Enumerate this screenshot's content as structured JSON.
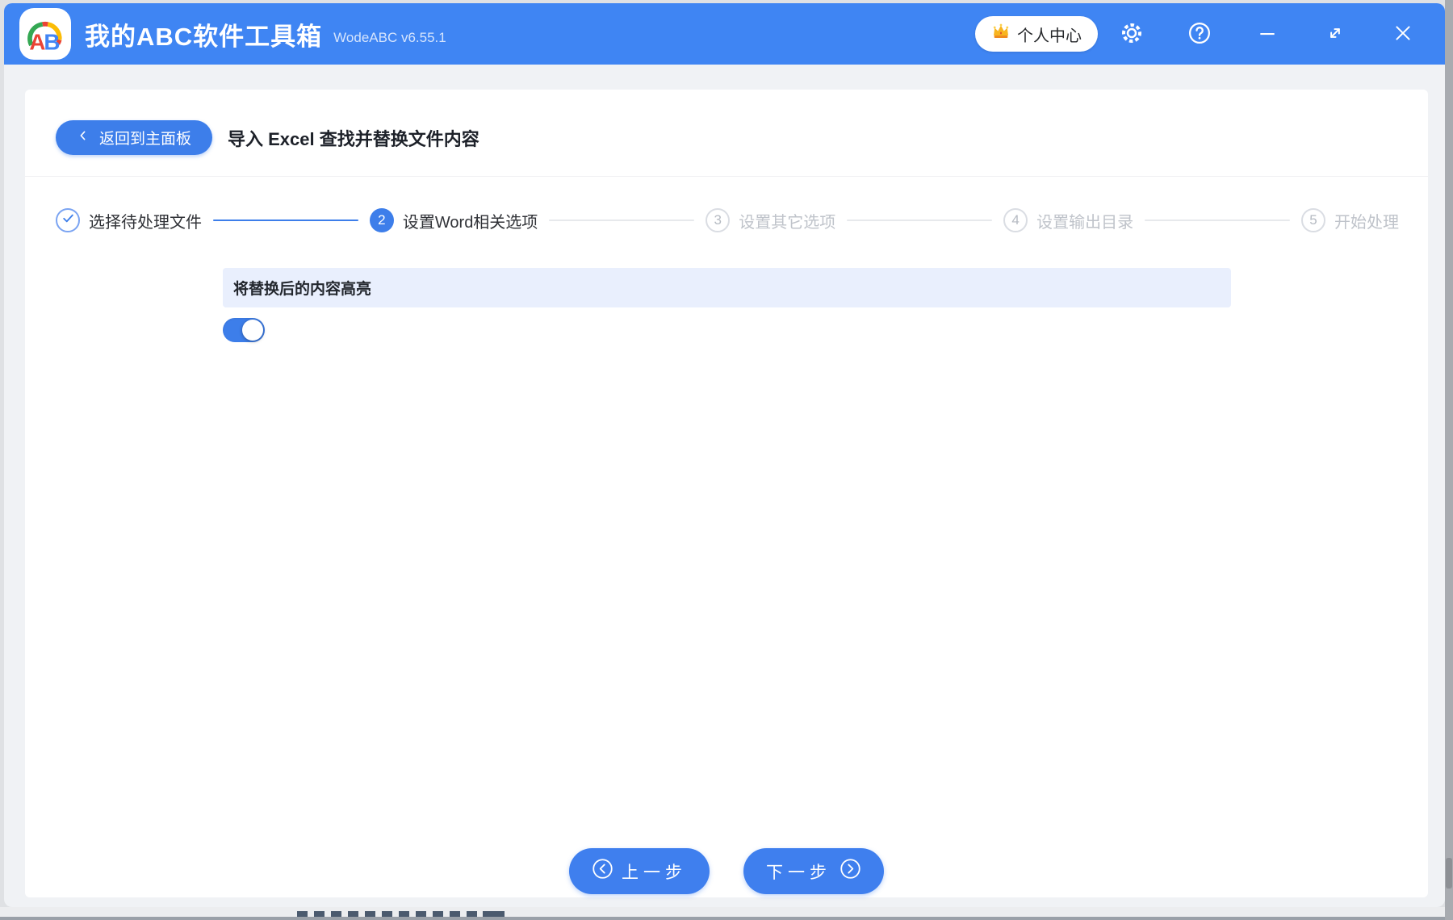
{
  "titlebar": {
    "app_title": "我的ABC软件工具箱",
    "app_version": "WodeABC v6.55.1",
    "user_center": "个人中心",
    "logo_letters": {
      "a": "A",
      "b": "B"
    }
  },
  "toolbar": {
    "back_label": "返回到主面板",
    "page_title": "导入 Excel 查找并替换文件内容"
  },
  "steps": [
    {
      "num": "1",
      "label": "选择待处理文件",
      "state": "completed"
    },
    {
      "num": "2",
      "label": "设置Word相关选项",
      "state": "active"
    },
    {
      "num": "3",
      "label": "设置其它选项",
      "state": "pending"
    },
    {
      "num": "4",
      "label": "设置输出目录",
      "state": "pending"
    },
    {
      "num": "5",
      "label": "开始处理",
      "state": "pending"
    }
  ],
  "options": {
    "highlight_label": "将替换后的内容高亮",
    "highlight_toggle_on": true
  },
  "footer": {
    "prev_label": "上一步",
    "next_label": "下一步"
  },
  "colors": {
    "titlebar_blue": "#3f85f3",
    "accent_blue": "#3d7eea",
    "button_blue": "#3f7fee",
    "option_bar_bg": "#e9effd",
    "pending_gray": "#bfc3ca",
    "logo_red": "#ea4335",
    "logo_blue": "#4285f4",
    "logo_green": "#34a853",
    "logo_yellow": "#fbbc05"
  }
}
